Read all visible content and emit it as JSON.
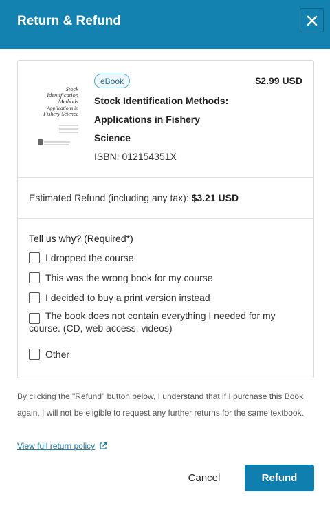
{
  "header": {
    "title": "Return & Refund",
    "close_icon": "close-icon"
  },
  "book": {
    "cover": {
      "title_lines": [
        "Stock",
        "Identification",
        "Methods",
        "Applications in",
        "Fishery Science"
      ]
    },
    "badge": "eBook",
    "price": "$2.99 USD",
    "title": "Stock Identification Methods: Applications in Fishery Science",
    "isbn": "ISBN: 012154351X"
  },
  "refund": {
    "label": "Estimated Refund (including any tax): ",
    "amount": "$3.21 USD"
  },
  "reasons": {
    "label": "Tell us why? (Required*)",
    "options": [
      "I dropped the course",
      "This was the wrong book for my course",
      "I decided to buy a print version instead",
      "The book does not contain everything I needed for my course. (CD, web access, videos)",
      "Other"
    ]
  },
  "disclaimer": "By clicking the \"Refund\" button below, I understand that if I purchase this Book again, I will not be eligible to request any further returns for the same textbook.",
  "policy_link": {
    "label": "View full return policy",
    "icon": "external-link-icon"
  },
  "actions": {
    "cancel": "Cancel",
    "refund": "Refund"
  },
  "colors": {
    "header": "#1482b1",
    "primary_button": "#0f7fb0",
    "link": "#1a7ba8"
  }
}
